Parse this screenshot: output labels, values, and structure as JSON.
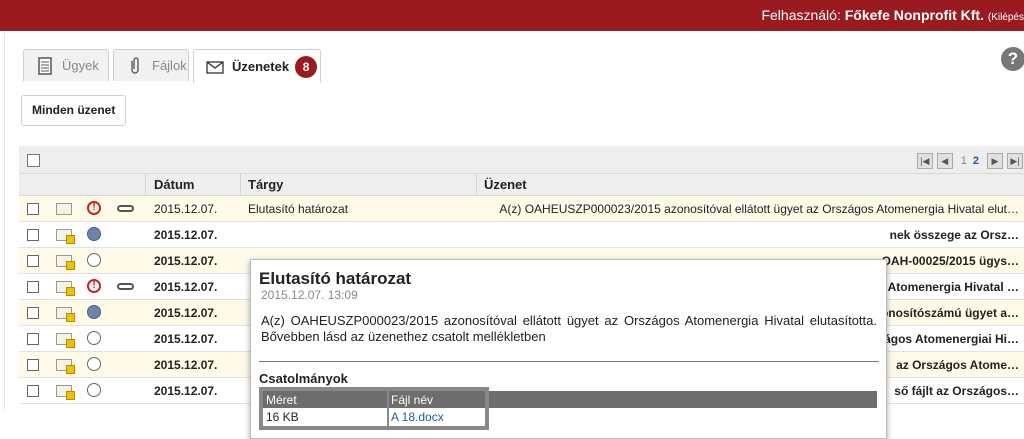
{
  "header": {
    "user_label": "Felhasználó:",
    "user_name": "Főkefe Nonprofit Kft.",
    "logout": "(Kilépés"
  },
  "tabs": [
    {
      "label": "Ügyek",
      "icon": "document-icon"
    },
    {
      "label": "Fájlok",
      "icon": "paperclip-icon"
    },
    {
      "label": "Üzenetek",
      "icon": "envelope-icon",
      "badge": "8"
    }
  ],
  "help": "?",
  "toolbar": {
    "all_messages": "Minden üzenet"
  },
  "pager": {
    "pages": [
      "1",
      "2"
    ],
    "current": "2"
  },
  "table": {
    "headers": [
      "Dátum",
      "Tárgy",
      "Üzenet"
    ],
    "rows": [
      {
        "date": "2015.12.07.",
        "subject": "Elutasító határozat",
        "message": "A(z) OAHEUSZP000023/2015 azonosítóval ellátott ügyet az Országos Atomenergia Hivatal elut…",
        "unread": false,
        "priority": "high",
        "attachment": true
      },
      {
        "date": "2015.12.07.",
        "subject": "",
        "message": "nek összege az Orsz…",
        "unread": true,
        "priority": "mid",
        "attachment": false
      },
      {
        "date": "2015.12.07.",
        "subject": "",
        "message": "OAH-00025/2015 ügys…",
        "unread": true,
        "priority": "low",
        "attachment": false
      },
      {
        "date": "2015.12.07.",
        "subject": "",
        "message": "Atomenergia Hivatal …",
        "unread": true,
        "priority": "high",
        "attachment": true
      },
      {
        "date": "2015.12.07.",
        "subject": "",
        "message": "onosítószámú ügyet a…",
        "unread": true,
        "priority": "mid",
        "attachment": false
      },
      {
        "date": "2015.12.07.",
        "subject": "",
        "message": "ágos Atomenergiai Hi…",
        "unread": true,
        "priority": "low",
        "attachment": false
      },
      {
        "date": "2015.12.07.",
        "subject": "",
        "message": "az Országos Atome…",
        "unread": true,
        "priority": "low",
        "attachment": false
      },
      {
        "date": "2015.12.07.",
        "subject": "",
        "message": "ső fájlt az Országos…",
        "unread": true,
        "priority": "low",
        "attachment": false
      }
    ]
  },
  "popup": {
    "title": "Elutasító határozat",
    "datetime": "2015.12.07. 13:09",
    "body": "A(z) OAHEUSZP000023/2015 azonosítóval ellátott ügyet az Országos Atomenergia Hivatal elutasította. Bővebben lásd az üzenethez csatolt mellékletben",
    "attachments_title": "Csatolmányok",
    "attach_headers": {
      "size": "Méret",
      "name": "Fájl név"
    },
    "attachment": {
      "size": "16 KB",
      "name": "A 18.docx"
    }
  },
  "colors": {
    "brand": "#9a1b1f",
    "link": "#1f5fa8",
    "row_highlight": "#fffbe8"
  }
}
